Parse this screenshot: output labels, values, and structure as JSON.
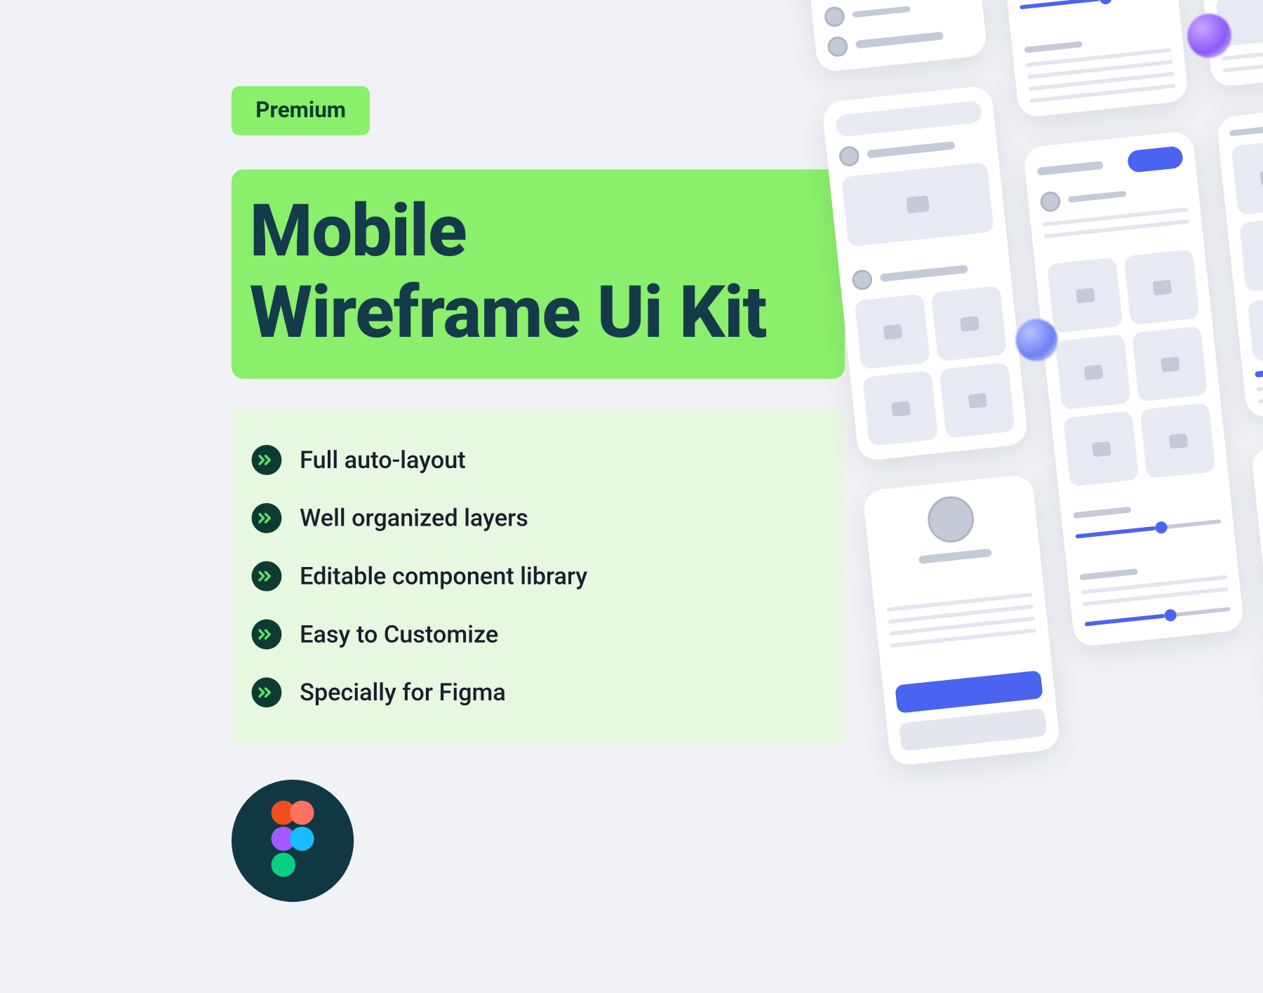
{
  "badge": "Premium",
  "title_line1": "Mobile",
  "title_line2": "Wireframe Ui Kit",
  "features": [
    "Full auto-layout",
    "Well organized layers",
    "Editable component library",
    "Easy to Customize",
    "Specially for Figma"
  ],
  "colors": {
    "accent_green": "#8aef6a",
    "dark_teal": "#0d3b30",
    "heading": "#153b4a",
    "wire_blue": "#4a63f0"
  }
}
